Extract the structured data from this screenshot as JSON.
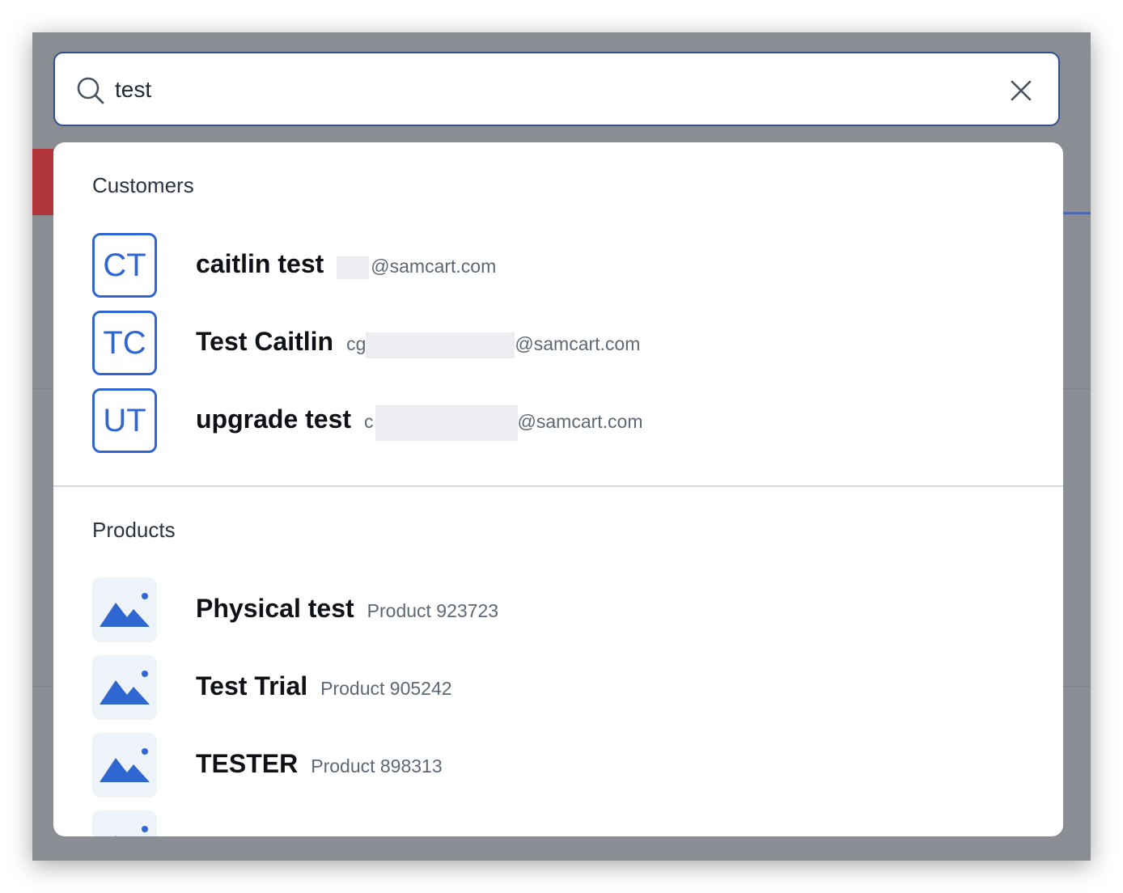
{
  "search": {
    "value": "test"
  },
  "sections": {
    "customers_title": "Customers",
    "products_title": "Products"
  },
  "customers": [
    {
      "initials": "CT",
      "name": "caitlin test",
      "email_prefix": "",
      "email_domain": "@samcart.com"
    },
    {
      "initials": "TC",
      "name": "Test Caitlin",
      "email_prefix": "cg",
      "email_domain": "@samcart.com"
    },
    {
      "initials": "UT",
      "name": "upgrade test",
      "email_prefix": "c",
      "email_domain": "@samcart.com"
    }
  ],
  "products": [
    {
      "name": "Physical test",
      "sub": "Product 923723"
    },
    {
      "name": "Test Trial",
      "sub": "Product 905242"
    },
    {
      "name": "TESTER",
      "sub": "Product 898313"
    }
  ],
  "colors": {
    "accent": "#2f66d0",
    "search_border": "#2f4f8f",
    "overlay": "#8a8e94"
  },
  "icons": {
    "search": "search-icon",
    "clear": "close-icon",
    "product_placeholder": "image-placeholder-icon"
  }
}
